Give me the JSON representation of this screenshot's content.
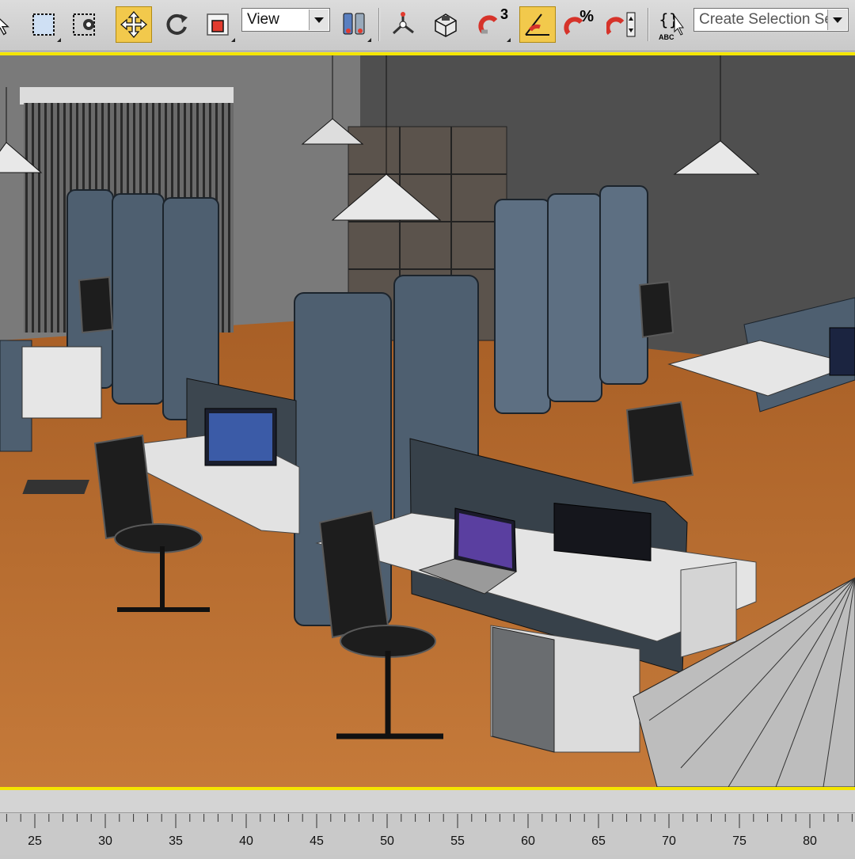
{
  "toolbar": {
    "view_dropdown_value": "View",
    "selection_set_placeholder": "Create Selection Set",
    "snap_badge": "3",
    "percent_badge": "%",
    "named_sel_label": "ABC"
  },
  "colors": {
    "active_button": "#f2c94c",
    "viewport_border": "#f4e500",
    "floor": "#b56a2e",
    "wall": "#5a5a5a",
    "panel": "#4e5f70",
    "desk": "#d9d9d9"
  },
  "timeline": {
    "ticks": [
      "25",
      "30",
      "35",
      "40",
      "45",
      "50",
      "55",
      "60",
      "65",
      "70",
      "75",
      "80"
    ]
  }
}
